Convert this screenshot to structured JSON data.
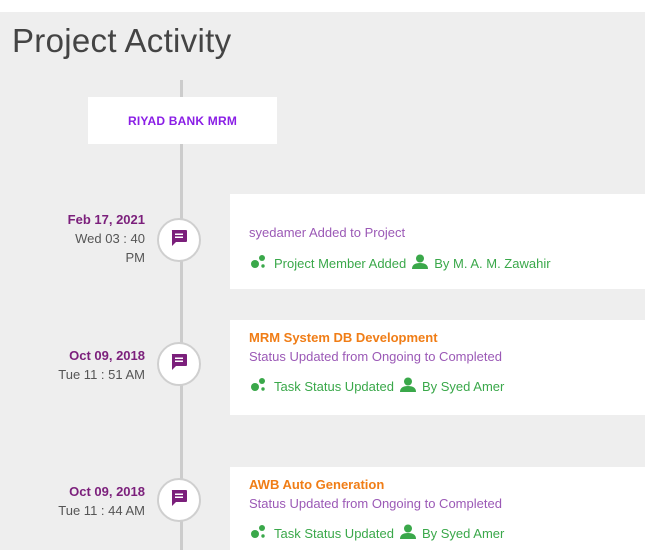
{
  "page": {
    "title": "Project Activity"
  },
  "project": {
    "name": "RIYAD BANK MRM"
  },
  "entries": [
    {
      "date": "Feb 17, 2021",
      "time": "Wed 03 : 40",
      "time2": "PM",
      "title": "",
      "text": "syedamer Added to Project",
      "activity": "Project Member Added",
      "by": "By M. A. M. Zawahir"
    },
    {
      "date": "Oct 09, 2018",
      "time": "Tue 11 : 51 AM",
      "title": "MRM System DB Development",
      "text": "Status Updated from Ongoing to Completed",
      "activity": "Task Status Updated",
      "by": "By Syed Amer"
    },
    {
      "date": "Oct 09, 2018",
      "time": "Tue 11 : 44 AM",
      "title": "AWB Auto Generation",
      "text": "Status Updated from Ongoing to Completed",
      "activity": "Task Status Updated",
      "by": "By Syed Amer"
    }
  ],
  "colors": {
    "accent_purple": "#7b1f7b",
    "project_name": "#8a1ee6",
    "title_orange": "#f07d16",
    "text_purple": "#9b59b6",
    "meta_green": "#3aa84a"
  },
  "icons": {
    "node": "comment-icon",
    "activity": "dots-icon",
    "user": "user-icon"
  }
}
